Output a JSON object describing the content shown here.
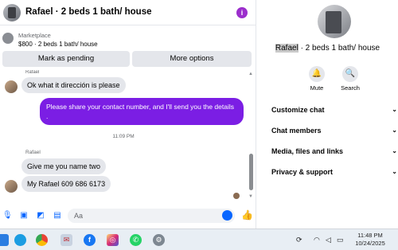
{
  "chat": {
    "title": "Rafael · 2 beds 1 bath/ house",
    "marketplace_label": "Marketplace",
    "listing": "$800 · 2 beds 1 bath/ house",
    "buttons": {
      "mark_pending": "Mark as pending",
      "more_options": "More options"
    },
    "messages": [
      {
        "sender": "Rafael",
        "text": "Ok what it  dirección is please",
        "direction": "in"
      },
      {
        "text": "Please share your contact number, and I'll send you the details .",
        "direction": "out"
      },
      {
        "timestamp": "11:09 PM"
      },
      {
        "sender": "Rafael",
        "text": "Give me you name two",
        "direction": "in"
      },
      {
        "text": "My Rafael 609 686 6173",
        "direction": "in"
      }
    ],
    "composer_placeholder": "Aa"
  },
  "details": {
    "title_name": "Rafael",
    "title_rest": " · 2 beds 1 bath/ house",
    "actions": [
      {
        "label": "Mute",
        "icon": "bell-icon"
      },
      {
        "label": "Search",
        "icon": "search-icon"
      }
    ],
    "sections": [
      "Customize chat",
      "Chat members",
      "Media, files and links",
      "Privacy & support"
    ]
  },
  "taskbar": {
    "time": "11:48 PM",
    "date": "10/24/2025",
    "apps": [
      "windows-icon",
      "edge-icon",
      "chrome-icon",
      "mail-icon",
      "facebook-icon",
      "instagram-icon",
      "whatsapp-icon",
      "settings-icon"
    ]
  },
  "colors": {
    "accent": "#7b1ee4",
    "messenger_blue": "#0866ff",
    "bubble_in": "#e4e6eb"
  }
}
